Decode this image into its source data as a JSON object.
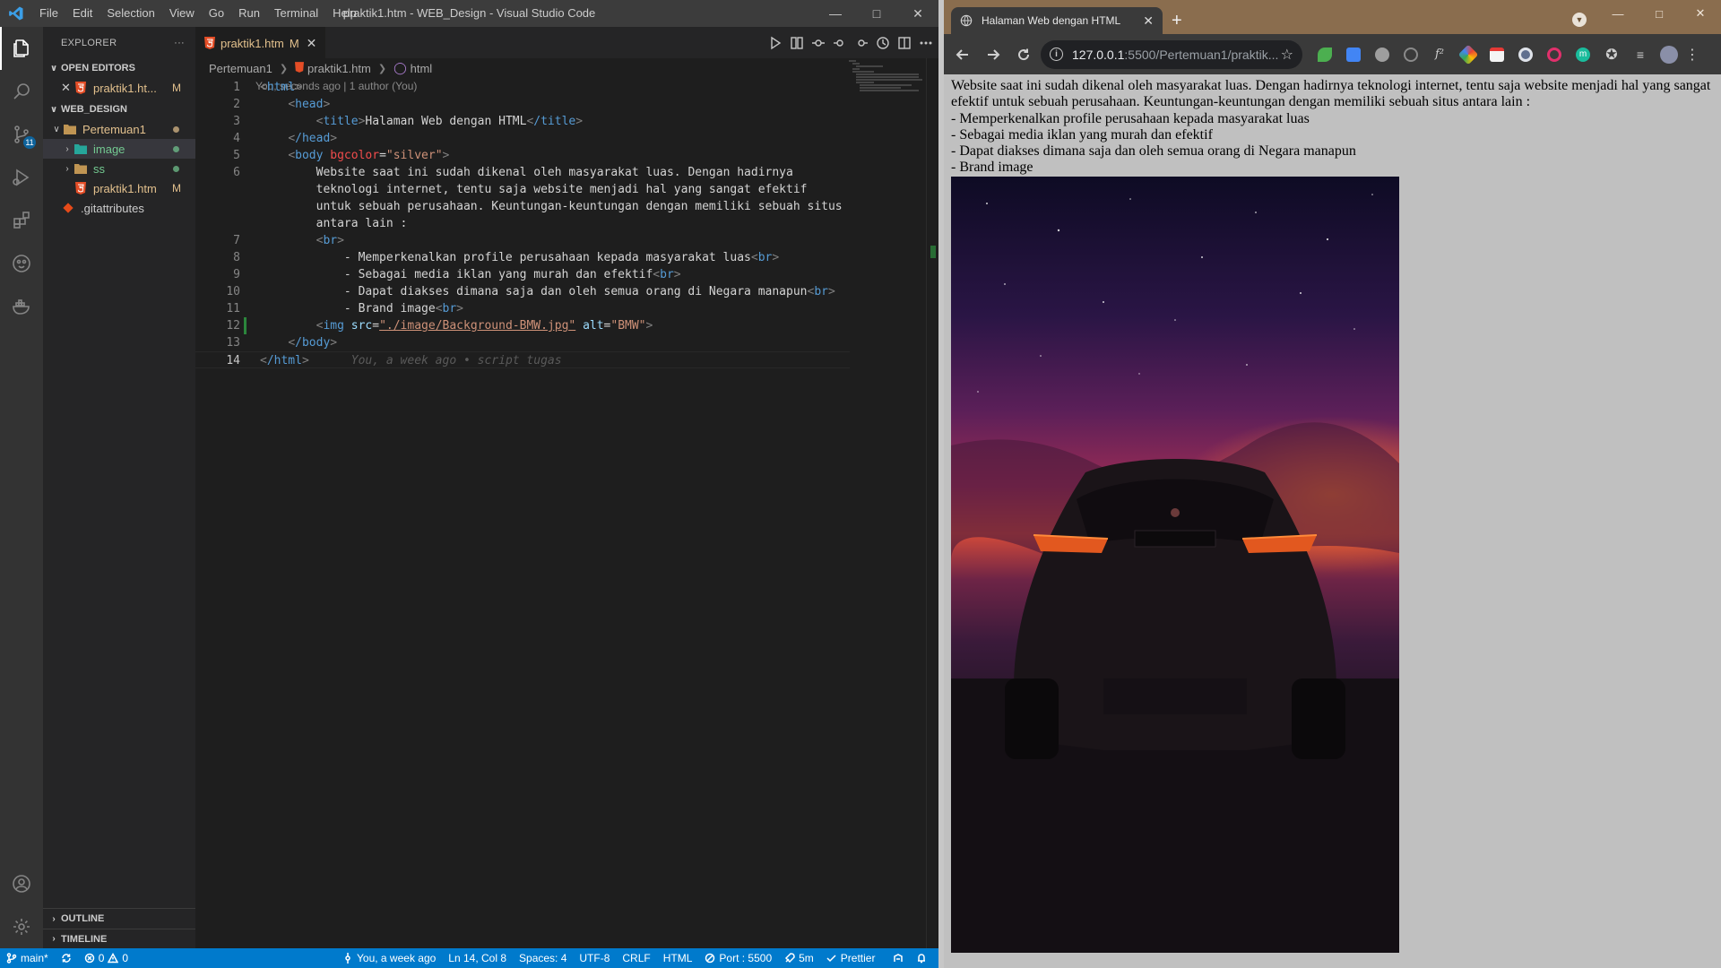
{
  "vscode": {
    "menu": [
      "File",
      "Edit",
      "Selection",
      "View",
      "Go",
      "Run",
      "Terminal",
      "Help"
    ],
    "window_title": "praktik1.htm - WEB_Design - Visual Studio Code",
    "explorer": {
      "title": "EXPLORER",
      "more": "···",
      "open_editors_label": "OPEN EDITORS",
      "open_editor_file": "praktik1.ht...",
      "open_editor_status": "M",
      "workspace_label": "WEB_DESIGN",
      "folder": "Pertemuan1",
      "items": [
        {
          "label": "image",
          "kind": "folder"
        },
        {
          "label": "ss",
          "kind": "folder"
        },
        {
          "label": "praktik1.htm",
          "kind": "file",
          "status": "M"
        }
      ],
      "root_file": ".gitattributes",
      "outline_label": "OUTLINE",
      "timeline_label": "TIMELINE"
    },
    "tab": {
      "label": "praktik1.htm",
      "status": "M"
    },
    "breadcrumb": [
      "Pertemuan1",
      "praktik1.htm",
      "html"
    ],
    "blame": "You, seconds ago | 1 author (You)",
    "line_numbers": [
      "1",
      "2",
      "3",
      "4",
      "5",
      "6",
      "",
      "",
      "",
      "7",
      "8",
      "9",
      "10",
      "11",
      "12",
      "13",
      "14"
    ],
    "code": {
      "l1_open": "<",
      "l1_tag": "html",
      "l1_close": ">",
      "l2_tag": "head",
      "l3_tag_open": "title",
      "l3_text": "Halaman Web dengan HTML",
      "l3_tag_close": "/title",
      "l4_tag": "/head",
      "l5_tag": "body",
      "l5_attr": "bgcolor",
      "l5_eq": "=",
      "l5_val": "\"silver\"",
      "l6a": "Website saat ini sudah dikenal oleh masyarakat luas. Dengan hadirnya",
      "l6b": "teknologi internet, tentu saja website menjadi hal yang sangat efektif",
      "l6c": "untuk sebuah perusahaan. Keuntungan-keuntungan dengan memiliki sebuah situs",
      "l6d": "antara lain :",
      "l7_tag": "br",
      "l8_text": "- Memperkenalkan profile perusahaan kepada masyarakat luas",
      "l9_text": "- Sebagai media iklan yang murah dan efektif",
      "l10_text": "- Dapat diakses dimana saja dan oleh semua orang di Negara manapun",
      "l11_text": "- Brand image",
      "l12_tag": "img",
      "l12_attr1": "src",
      "l12_val1": "\"./image/Background-BMW.jpg\"",
      "l12_attr2": "alt",
      "l12_val2": "\"BMW\"",
      "l13_tag": "/body",
      "l14_tag": "/html",
      "ghost": "You, a week ago • script tugas"
    },
    "status": {
      "branch": "main*",
      "errors": "0",
      "warnings": "0",
      "blame": "You, a week ago",
      "position": "Ln 14, Col 8",
      "spaces": "Spaces: 4",
      "encoding": "UTF-8",
      "eol": "CRLF",
      "language": "HTML",
      "port": "Port : 5500",
      "time": "5m",
      "prettier": "Prettier"
    }
  },
  "chrome": {
    "tab_title": "Halaman Web dengan HTML",
    "url_host": "127.0.0.1",
    "url_path": ":5500/Pertemuan1/praktik...",
    "page": {
      "paragraph": "Website saat ini sudah dikenal oleh masyarakat luas. Dengan hadirnya teknologi internet, tentu saja website menjadi hal yang sangat efektif untuk sebuah perusahaan. Keuntungan-keuntungan dengan memiliki sebuah situs antara lain :",
      "bullets": [
        "- Memperkenalkan profile perusahaan kepada masyarakat luas",
        "- Sebagai media iklan yang murah dan efektif",
        "- Dapat diakses dimana saja dan oleh semua orang di Negara manapun",
        "- Brand image"
      ],
      "image_alt": "BMW"
    },
    "extension_icons": [
      "leaf-icon",
      "translate-icon",
      "gear-icon",
      "crosshair-icon",
      "formula-icon",
      "color-picker-icon",
      "note-icon",
      "circle-icon",
      "ring-icon",
      "m-icon",
      "puzzle-icon",
      "playlist-icon",
      "profile-icon",
      "menu-icon"
    ],
    "colors": {
      "tabstrip": "#8a6d4e",
      "page_bg": "#c0c0c0"
    }
  }
}
